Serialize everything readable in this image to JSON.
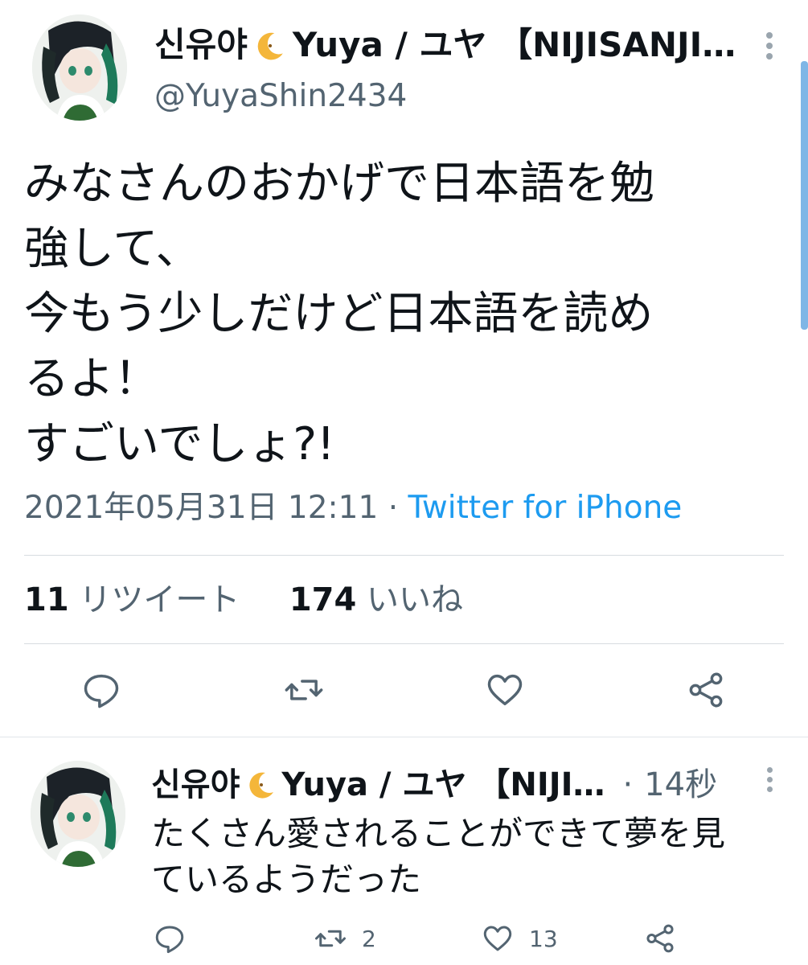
{
  "tweet": {
    "display_name": "신유야",
    "display_name_suffix": "Yuya / ユヤ 【NIJISANJI…",
    "handle": "@YuyaShin2434",
    "text_lines": [
      "みなさんのおかげで日本語を勉",
      "強して、",
      "今もう少しだけど日本語を読め",
      "るよ！",
      "すごいでしょ?!"
    ],
    "timestamp": "2021年05月31日 12:11",
    "separator": "·",
    "source": "Twitter for iPhone",
    "retweet_count": "11",
    "retweet_label": "リツイート",
    "like_count": "174",
    "like_label": "いいね",
    "actions": [
      "reply-icon",
      "retweet-icon",
      "like-icon",
      "share-icon"
    ]
  },
  "reply": {
    "display_name": "신유야",
    "display_name_suffix": "Yuya / ユヤ 【NIJI…",
    "separator": "·",
    "time": "14秒",
    "text_lines": [
      "たくさん愛されることができて夢を見",
      "ているようだった"
    ],
    "retweet_count": "2",
    "like_count": "13",
    "actions": [
      "reply-icon",
      "retweet-icon",
      "like-icon",
      "share-icon"
    ]
  },
  "colors": {
    "text": "#0f1419",
    "secondary": "#536471",
    "link": "#1d9bf0",
    "divider": "#d7dce0",
    "icon": "#536471"
  }
}
